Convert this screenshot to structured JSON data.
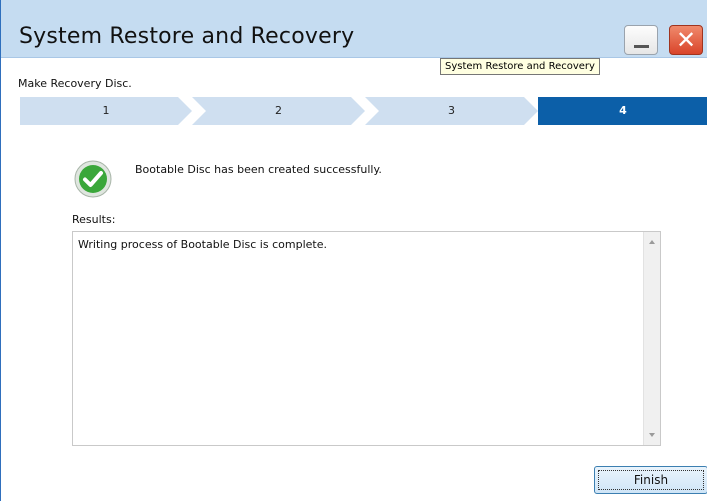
{
  "window": {
    "title": "System Restore and Recovery",
    "tooltip": "System Restore and Recovery",
    "minimize_icon": "minimize-icon",
    "close_icon": "close-icon",
    "close_glyph": "✕"
  },
  "wizard": {
    "subtitle": "Make Recovery Disc.",
    "steps": [
      {
        "label": "1",
        "active": false
      },
      {
        "label": "2",
        "active": false
      },
      {
        "label": "3",
        "active": false
      },
      {
        "label": "4",
        "active": true
      }
    ],
    "colors": {
      "step_inactive": "#cfdff0",
      "step_active": "#0c5fa8",
      "success_green": "#3aa73a"
    }
  },
  "status": {
    "icon": "checkmark-success-icon",
    "message": "Bootable Disc has been created successfully."
  },
  "results": {
    "label": "Results:",
    "text": "Writing process of Bootable Disc is complete."
  },
  "buttons": {
    "finish_label": "Finish"
  }
}
